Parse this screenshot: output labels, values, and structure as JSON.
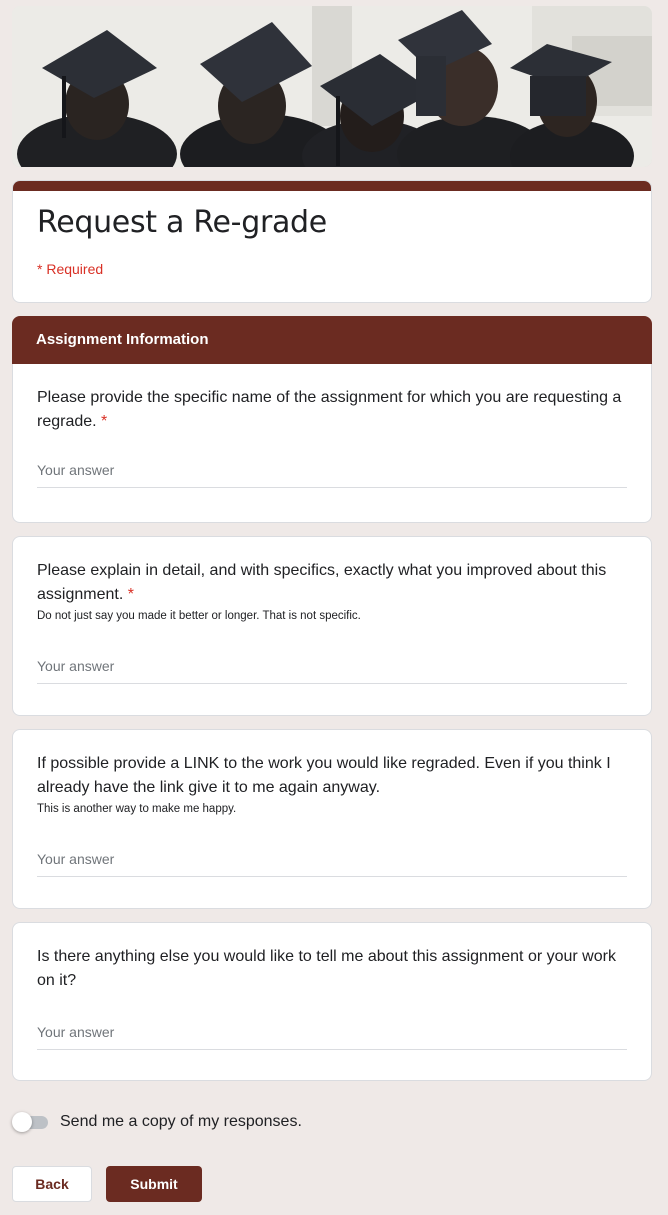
{
  "header": {
    "banner_image": "graduates-in-caps-photo"
  },
  "form": {
    "title": "Request a Re-grade",
    "required_note": "* Required",
    "accent_color": "#6b2b21",
    "section_title": "Assignment Information"
  },
  "questions": [
    {
      "title": "Please provide the specific name of the assignment for which you are requesting a regrade.",
      "required_mark": "*",
      "description": "",
      "placeholder": "Your answer"
    },
    {
      "title": "Please explain in detail, and with specifics, exactly what you improved about this assignment.",
      "required_mark": "*",
      "description": "Do not just say you made it better or longer. That is not specific.",
      "placeholder": "Your answer"
    },
    {
      "title": "If possible provide a LINK to the work you would like regraded. Even if you think I already have the link give it to me again anyway.",
      "required_mark": "",
      "description": "This is another way to make me happy.",
      "placeholder": "Your answer"
    },
    {
      "title": "Is there anything else you would like to tell me about this assignment or your work on it?",
      "required_mark": "",
      "description": "",
      "placeholder": "Your answer"
    }
  ],
  "footer": {
    "copy_label": "Send me a copy of my responses.",
    "copy_enabled": false,
    "back_label": "Back",
    "submit_label": "Submit"
  }
}
